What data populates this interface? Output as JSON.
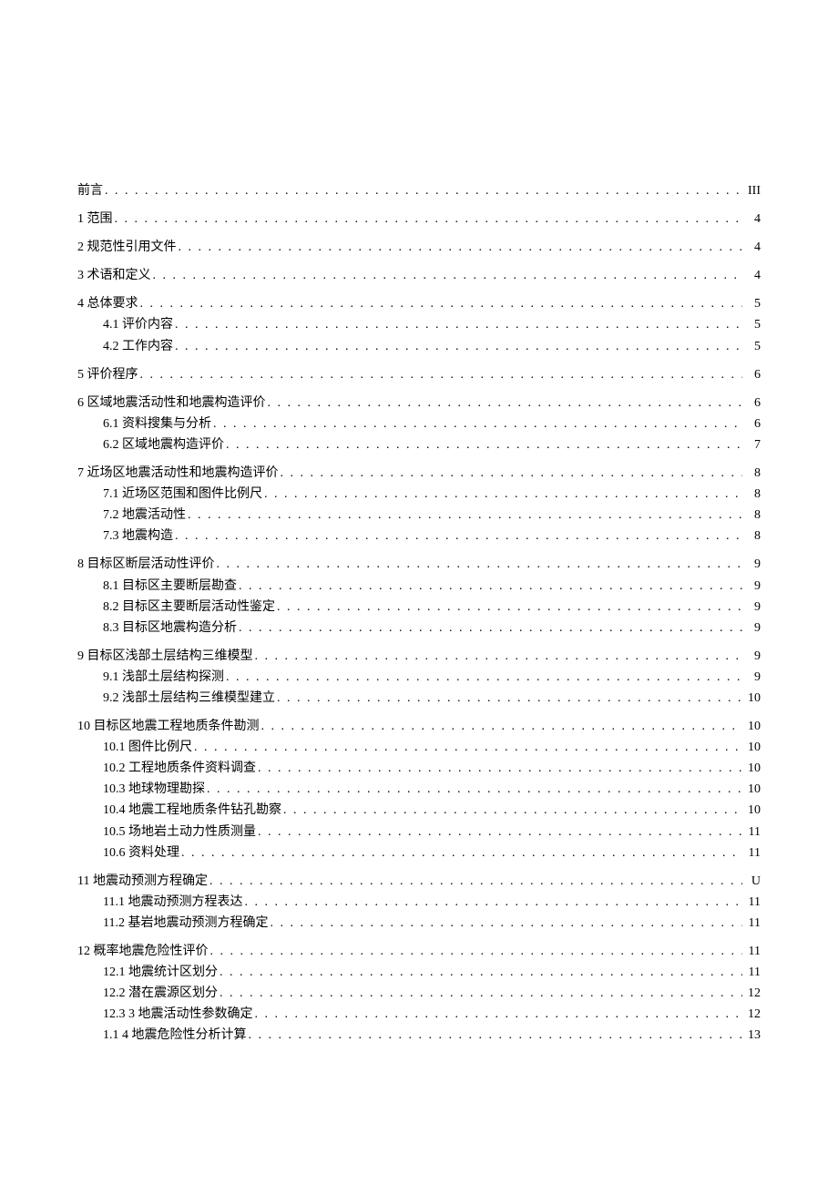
{
  "toc": [
    {
      "level": 0,
      "label": "前言",
      "page": "III"
    },
    {
      "level": 0,
      "label": "1 范围",
      "page": "4"
    },
    {
      "level": 0,
      "label": "2 规范性引用文件",
      "page": "4"
    },
    {
      "level": 0,
      "label": "3 术语和定义",
      "page": "4"
    },
    {
      "level": 0,
      "label": "4 总体要求",
      "page": "5"
    },
    {
      "level": 1,
      "label": "4.1 评价内容",
      "page": "5"
    },
    {
      "level": 1,
      "label": "4.2 工作内容",
      "page": "5"
    },
    {
      "level": 0,
      "label": "5 评价程序",
      "page": "6"
    },
    {
      "level": 0,
      "label": "6 区域地震活动性和地震构造评价",
      "page": "6"
    },
    {
      "level": 1,
      "label": "6.1 资料搜集与分析",
      "page": "6"
    },
    {
      "level": 1,
      "label": "6.2 区域地震构造评价",
      "page": "7"
    },
    {
      "level": 0,
      "label": "7 近场区地震活动性和地震构造评价",
      "page": "8"
    },
    {
      "level": 1,
      "label": "7.1 近场区范围和图件比例尺",
      "page": "8"
    },
    {
      "level": 1,
      "label": "7.2 地震活动性",
      "page": "8"
    },
    {
      "level": 1,
      "label": "7.3 地震构造",
      "page": "8"
    },
    {
      "level": 0,
      "label": "8 目标区断层活动性评价",
      "page": "9"
    },
    {
      "level": 1,
      "label": "8.1    目标区主要断层勘查",
      "page": "9"
    },
    {
      "level": 1,
      "label": "8.2    目标区主要断层活动性鉴定",
      "page": "9"
    },
    {
      "level": 1,
      "label": "8.3    目标区地震构造分析",
      "page": "9"
    },
    {
      "level": 0,
      "label": "9 目标区浅部土层结构三维模型",
      "page": "9"
    },
    {
      "level": 1,
      "label": "9.1    浅部土层结构探测",
      "page": "9"
    },
    {
      "level": 1,
      "label": "9.2    浅部土层结构三维模型建立",
      "page": "10"
    },
    {
      "level": 0,
      "label": "10 目标区地震工程地质条件勘测",
      "page": "10"
    },
    {
      "level": 1,
      "label": "10.1    图件比例尺",
      "page": "10"
    },
    {
      "level": 1,
      "label": "10.2 工程地质条件资料调查",
      "page": "10"
    },
    {
      "level": 1,
      "label": "10.3    地球物理勘探",
      "page": "10"
    },
    {
      "level": 1,
      "label": "10.4 地震工程地质条件钻孔勘察",
      "page": "10"
    },
    {
      "level": 1,
      "label": "10.5    场地岩土动力性质测量",
      "page": "11"
    },
    {
      "level": 1,
      "label": "10.6    资料处理",
      "page": "11"
    },
    {
      "level": 0,
      "label": "11 地震动预测方程确定",
      "page": "U"
    },
    {
      "level": 1,
      "label": "11.1    地震动预测方程表达",
      "page": "11"
    },
    {
      "level": 1,
      "label": "11.2    基岩地震动预测方程确定",
      "page": "11"
    },
    {
      "level": 0,
      "label": "12 概率地震危险性评价",
      "page": "11"
    },
    {
      "level": 1,
      "label": "12.1    地震统计区划分",
      "page": "11"
    },
    {
      "level": 1,
      "label": "12.2    潜在震源区划分",
      "page": "12"
    },
    {
      "level": 1,
      "label": "12.3    3 地震活动性参数确定",
      "page": "12"
    },
    {
      "level": 1,
      "label": "1.1   4 地震危险性分析计算",
      "page": "13"
    }
  ]
}
